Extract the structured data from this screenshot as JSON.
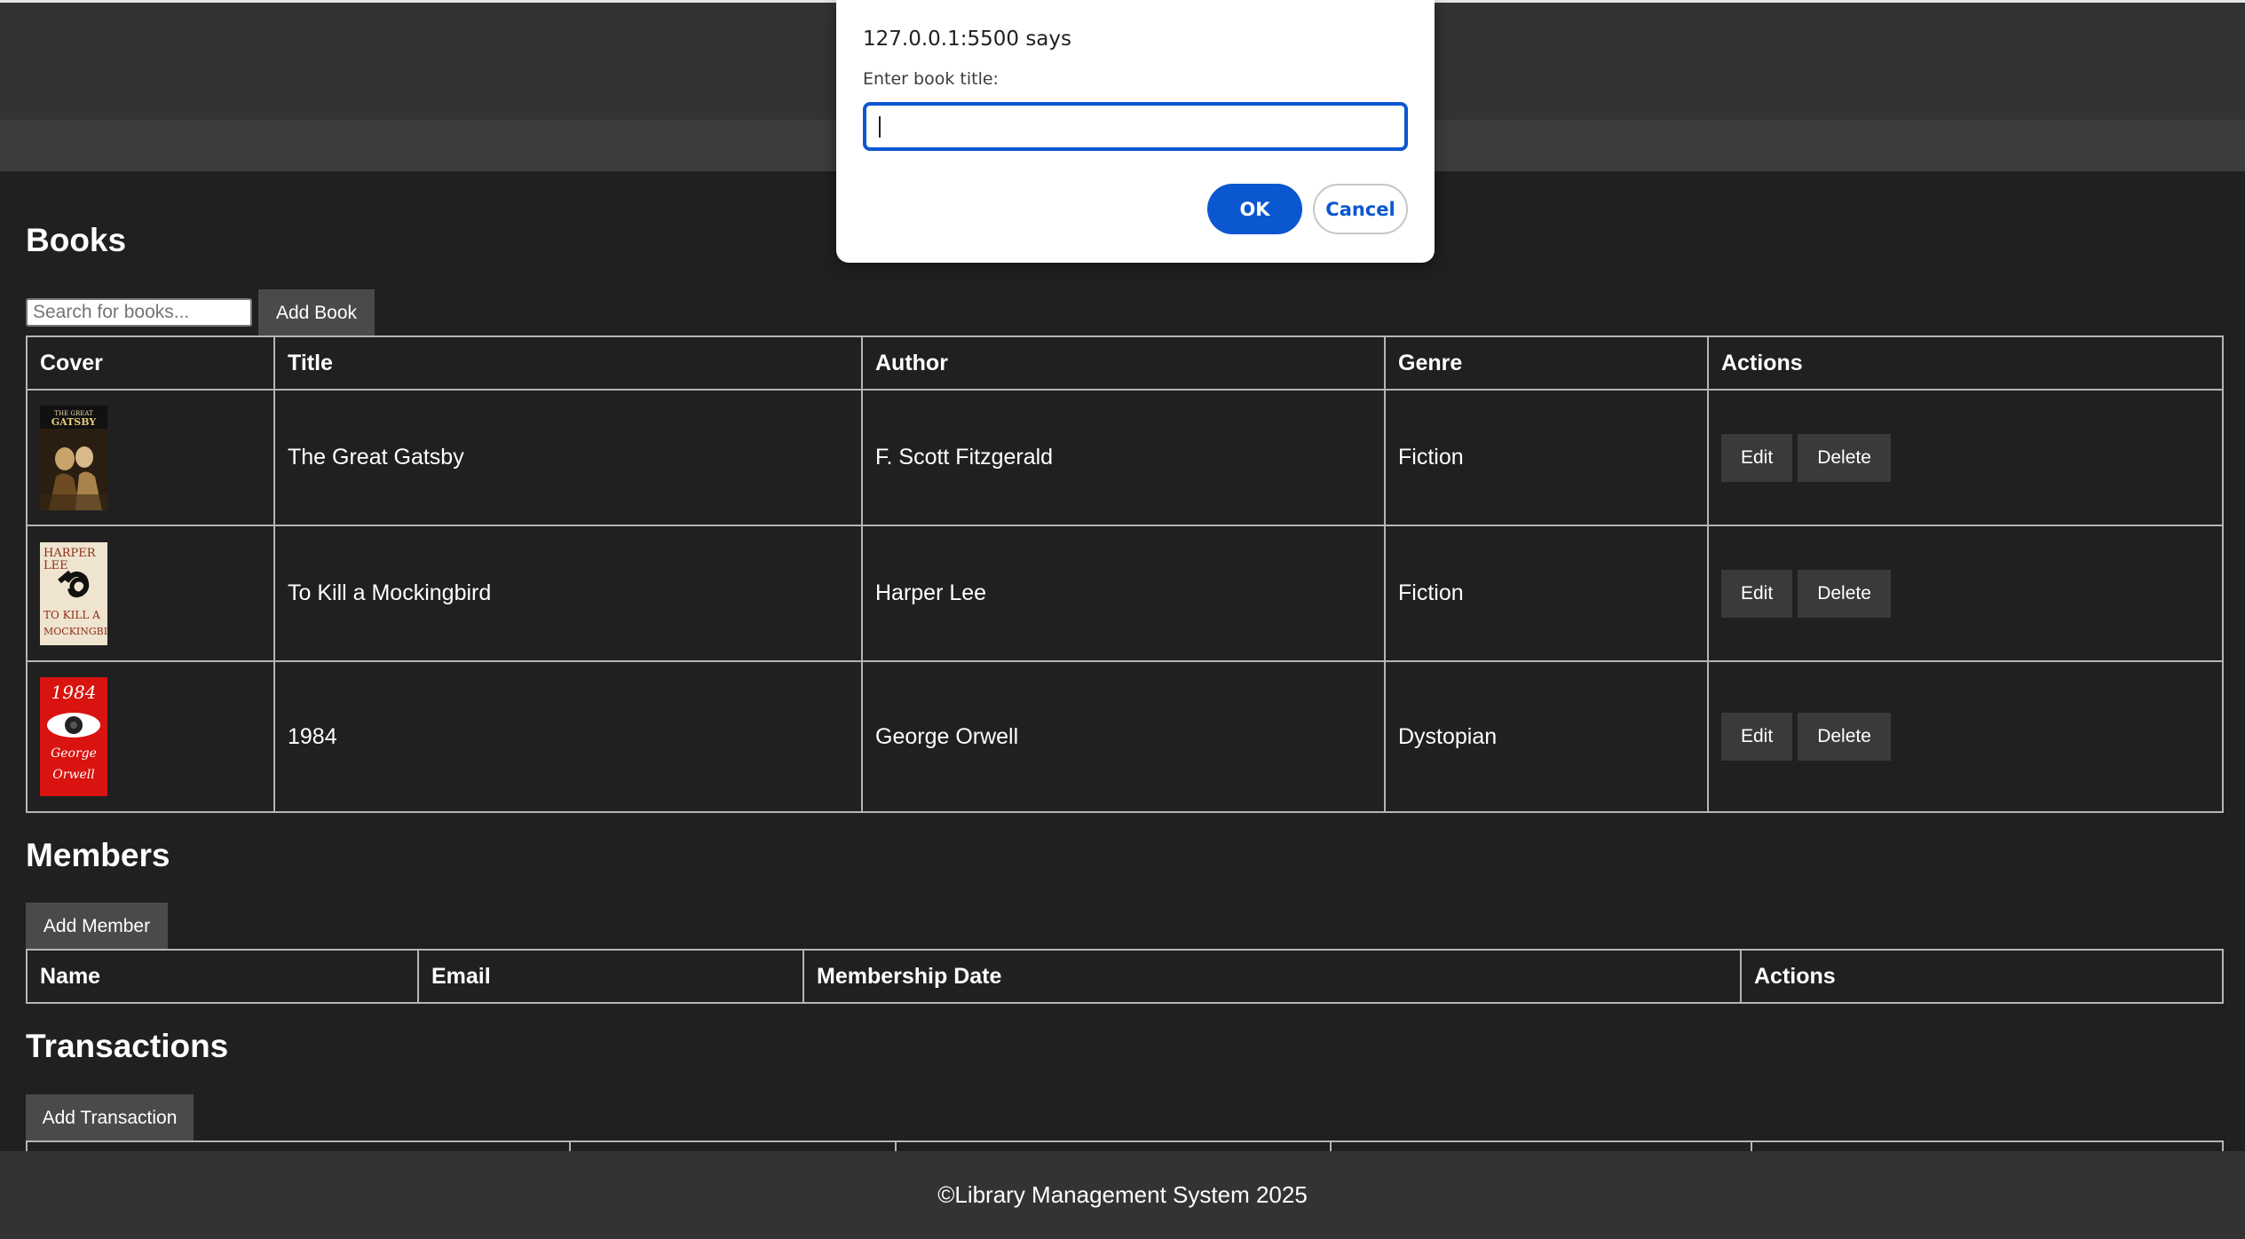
{
  "books": {
    "heading": "Books",
    "search_placeholder": "Search for books...",
    "add_label": "Add Book",
    "columns": [
      "Cover",
      "Title",
      "Author",
      "Genre",
      "Actions"
    ],
    "rows": [
      {
        "title": "The Great Gatsby",
        "author": "F. Scott Fitzgerald",
        "genre": "Fiction",
        "cover_text": "THE GREAT GATSBY",
        "edit": "Edit",
        "delete": "Delete"
      },
      {
        "title": "To Kill a Mockingbird",
        "author": "Harper Lee",
        "genre": "Fiction",
        "cover_text": "HARPER LEE TO KILL A MOCKINGBIRD",
        "edit": "Edit",
        "delete": "Delete"
      },
      {
        "title": "1984",
        "author": "George Orwell",
        "genre": "Dystopian",
        "cover_text": "1984 George Orwell",
        "edit": "Edit",
        "delete": "Delete"
      }
    ]
  },
  "members": {
    "heading": "Members",
    "add_label": "Add Member",
    "columns": [
      "Name",
      "Email",
      "Membership Date",
      "Actions"
    ]
  },
  "transactions": {
    "heading": "Transactions",
    "add_label": "Add Transaction"
  },
  "footer": {
    "text": "©Library Management System 2025"
  },
  "dialog": {
    "title": "127.0.0.1:5500 says",
    "message": "Enter book title:",
    "input_value": "",
    "ok_label": "OK",
    "cancel_label": "Cancel"
  },
  "colors": {
    "background": "#202020",
    "header": "#333333",
    "accent": "#0b57d0"
  }
}
